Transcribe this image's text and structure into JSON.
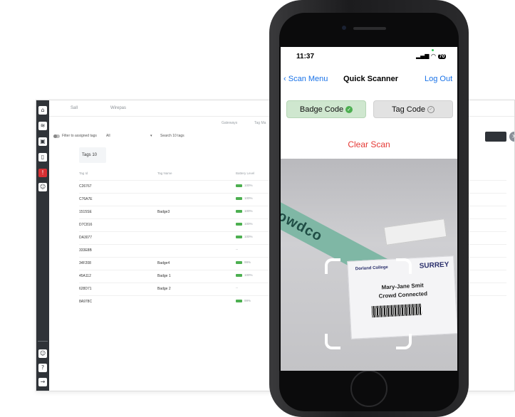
{
  "desktop": {
    "tabs": [
      "Sall",
      "Wirepas"
    ],
    "sub_tabs": [
      "Gateways",
      "Tag Ma"
    ],
    "filter_label": "Filter to assigned tags",
    "filter_select": "All",
    "search_placeholder": "Search 10 tags",
    "tags_count": "Tags 10",
    "columns": [
      "Tag Id",
      "Tag Name",
      "Battery Level"
    ],
    "rows": [
      {
        "id": "C26767",
        "name": "",
        "battery": "100%"
      },
      {
        "id": "C76A7E",
        "name": "",
        "battery": "100%"
      },
      {
        "id": "1515SE",
        "name": "Badge3",
        "battery": "100%"
      },
      {
        "id": "D7C816",
        "name": "",
        "battery": "100%"
      },
      {
        "id": "DA3077",
        "name": "",
        "battery": "100%"
      },
      {
        "id": "333E8B",
        "name": "",
        "battery": "--"
      },
      {
        "id": "34F208",
        "name": "Badge4",
        "battery": "99%"
      },
      {
        "id": "45A112",
        "name": "Badge 1",
        "battery": "100%"
      },
      {
        "id": "628D71",
        "name": "Badge 2",
        "battery": "--"
      },
      {
        "id": "8A978C",
        "name": "",
        "battery": "99%"
      }
    ],
    "colors": {
      "rail": "#2f3338",
      "battery": "#4caf50"
    }
  },
  "phone": {
    "status_time": "11:37",
    "battery_level": "70",
    "nav": {
      "back_label": "Scan Menu",
      "title": "Quick Scanner",
      "logout_label": "Log Out"
    },
    "segments": {
      "badge_label": "Badge Code",
      "tag_label": "Tag Code"
    },
    "clear_scan_label": "Clear Scan",
    "badge": {
      "college": "Dorland College",
      "university": "SURREY",
      "name": "Mary-Jane Smit",
      "org": "Crowd Connected"
    },
    "lanyard_text": "crowdco",
    "colors": {
      "link": "#1a73e8",
      "clear_scan": "#e53935",
      "badge_active": "#cfe7cf"
    }
  }
}
